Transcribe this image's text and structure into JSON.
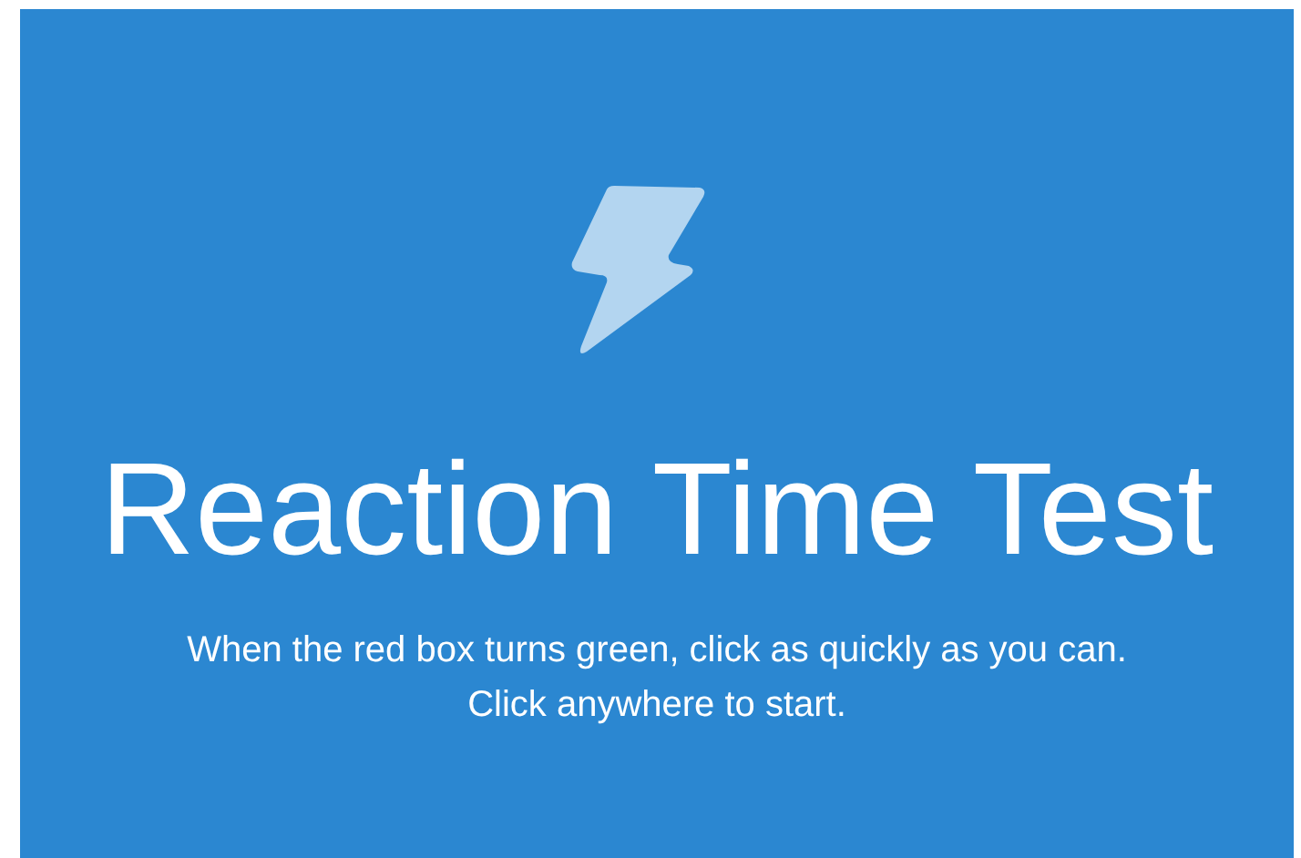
{
  "title": "Reaction Time Test",
  "instructions": [
    "When the red box turns green, click as quickly as you can.",
    "Click anywhere to start."
  ]
}
